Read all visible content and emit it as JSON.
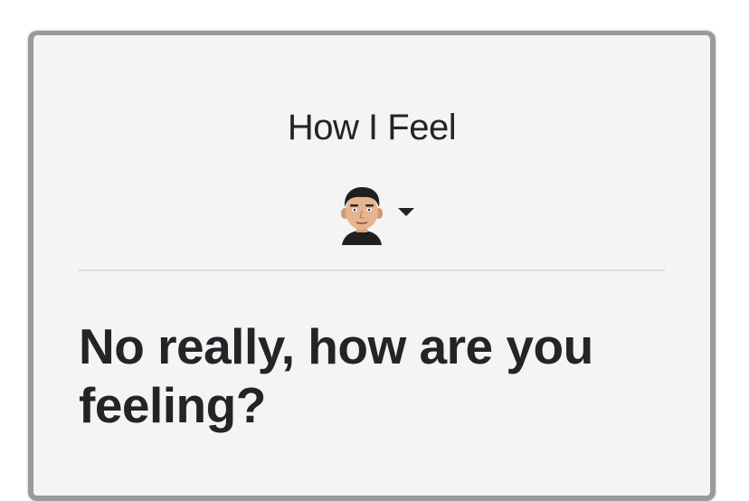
{
  "header": {
    "title": "How I Feel",
    "avatar_icon": "user-avatar-icon",
    "menu_icon": "caret-down-icon"
  },
  "main": {
    "question": "No really, how are you feeling?"
  }
}
